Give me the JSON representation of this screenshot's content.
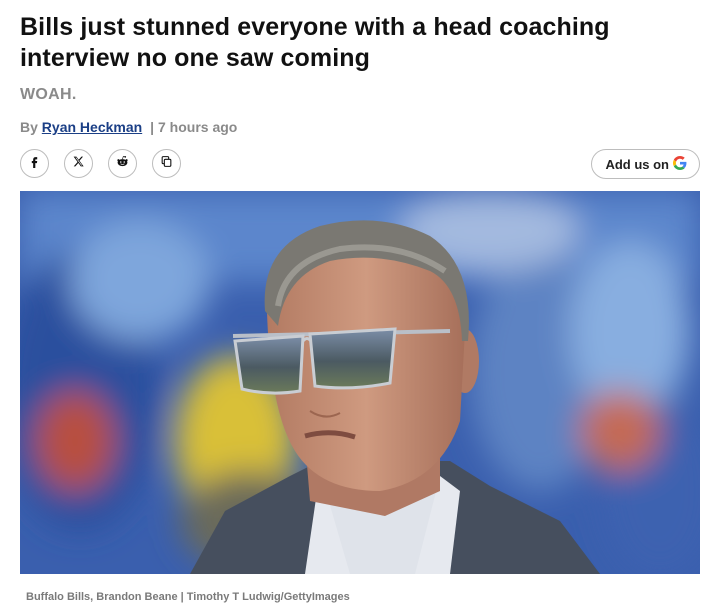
{
  "article": {
    "headline": "Bills just stunned everyone with a head coaching interview no one saw coming",
    "subheadline": "WOAH.",
    "byline_prefix": "By",
    "author": "Ryan Heckman",
    "separator": "|",
    "time_ago": "7 hours ago"
  },
  "share": {
    "icons": [
      "facebook-icon",
      "x-icon",
      "reddit-icon",
      "copy-link-icon"
    ]
  },
  "google": {
    "label": "Add us on",
    "icon": "google-icon"
  },
  "photo": {
    "caption": "Buffalo Bills, Brandon Beane | Timothy T Ludwig/GettyImages"
  },
  "colors": {
    "headline": "#111111",
    "muted": "#8a8a8a",
    "author_link": "#1b3f86",
    "border": "#bdbdbd"
  }
}
